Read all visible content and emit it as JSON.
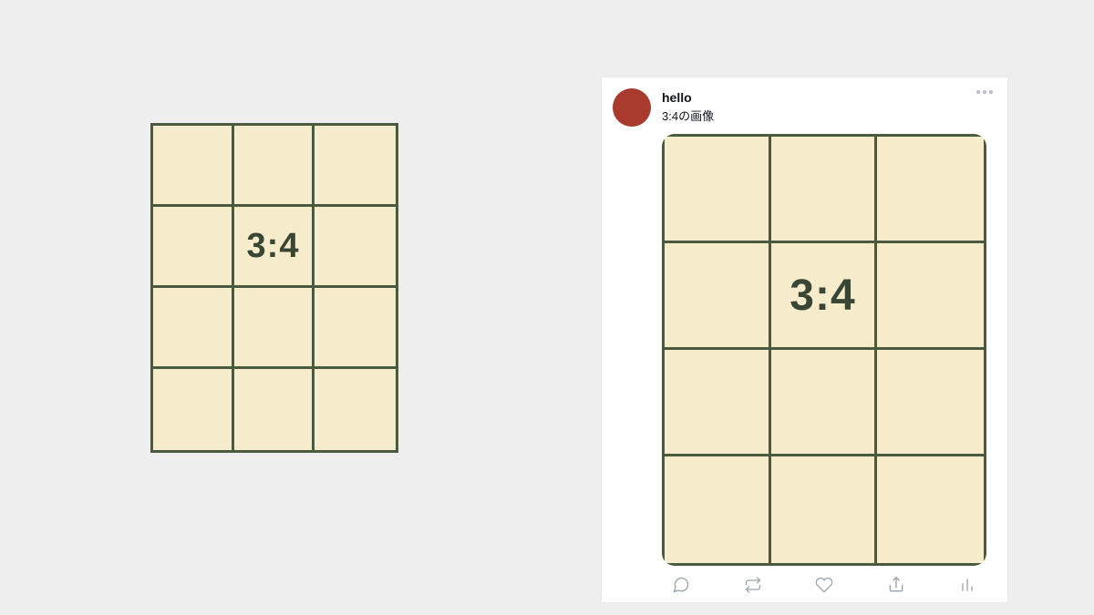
{
  "left_graphic": {
    "ratio_label": "3:4"
  },
  "post": {
    "user": "hello",
    "text": "3:4の画像",
    "image_ratio_label": "3:4"
  },
  "icons": {
    "more": "more-icon",
    "reply": "reply-icon",
    "repost": "repost-icon",
    "like": "like-icon",
    "share": "share-icon",
    "stats": "stats-icon"
  }
}
